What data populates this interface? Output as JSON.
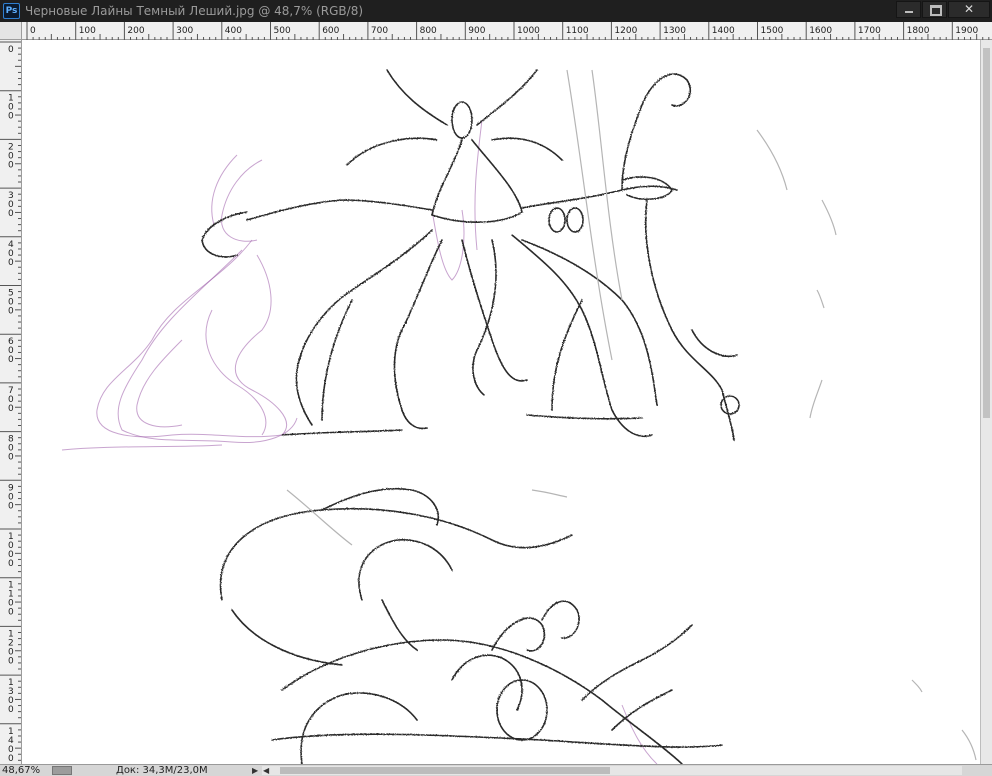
{
  "window": {
    "app_badge": "Ps",
    "title": "Черновые Лайны Темный Леший.jpg @ 48,7% (RGB/8)",
    "close_glyph": "✕"
  },
  "rulers": {
    "top_labels": [
      "0",
      "100",
      "200",
      "300",
      "400",
      "500",
      "600",
      "700",
      "800",
      "900",
      "1000",
      "1100",
      "1200",
      "1300",
      "1400",
      "1500",
      "1600",
      "1700",
      "1800",
      "1900"
    ],
    "left_labels": [
      "0",
      "100",
      "200",
      "300",
      "400",
      "500",
      "600",
      "700",
      "800",
      "900",
      "1000",
      "1100",
      "1200",
      "1300",
      "1400"
    ]
  },
  "status": {
    "zoom": "48,67%",
    "doc_size": "Док: 34,3M/23,0M",
    "arrow": "▶",
    "scroll_left": "◀"
  },
  "icons": {
    "minimize": "minimize-icon",
    "maximize": "maximize-icon",
    "close": "close-icon",
    "status_arrow": "play-arrow-icon"
  },
  "colors": {
    "titlebar": "#1f1f1f",
    "accent": "#2f7fd0",
    "sketch_line": "#2a2a2a",
    "smoke": "#9a5aa8"
  }
}
